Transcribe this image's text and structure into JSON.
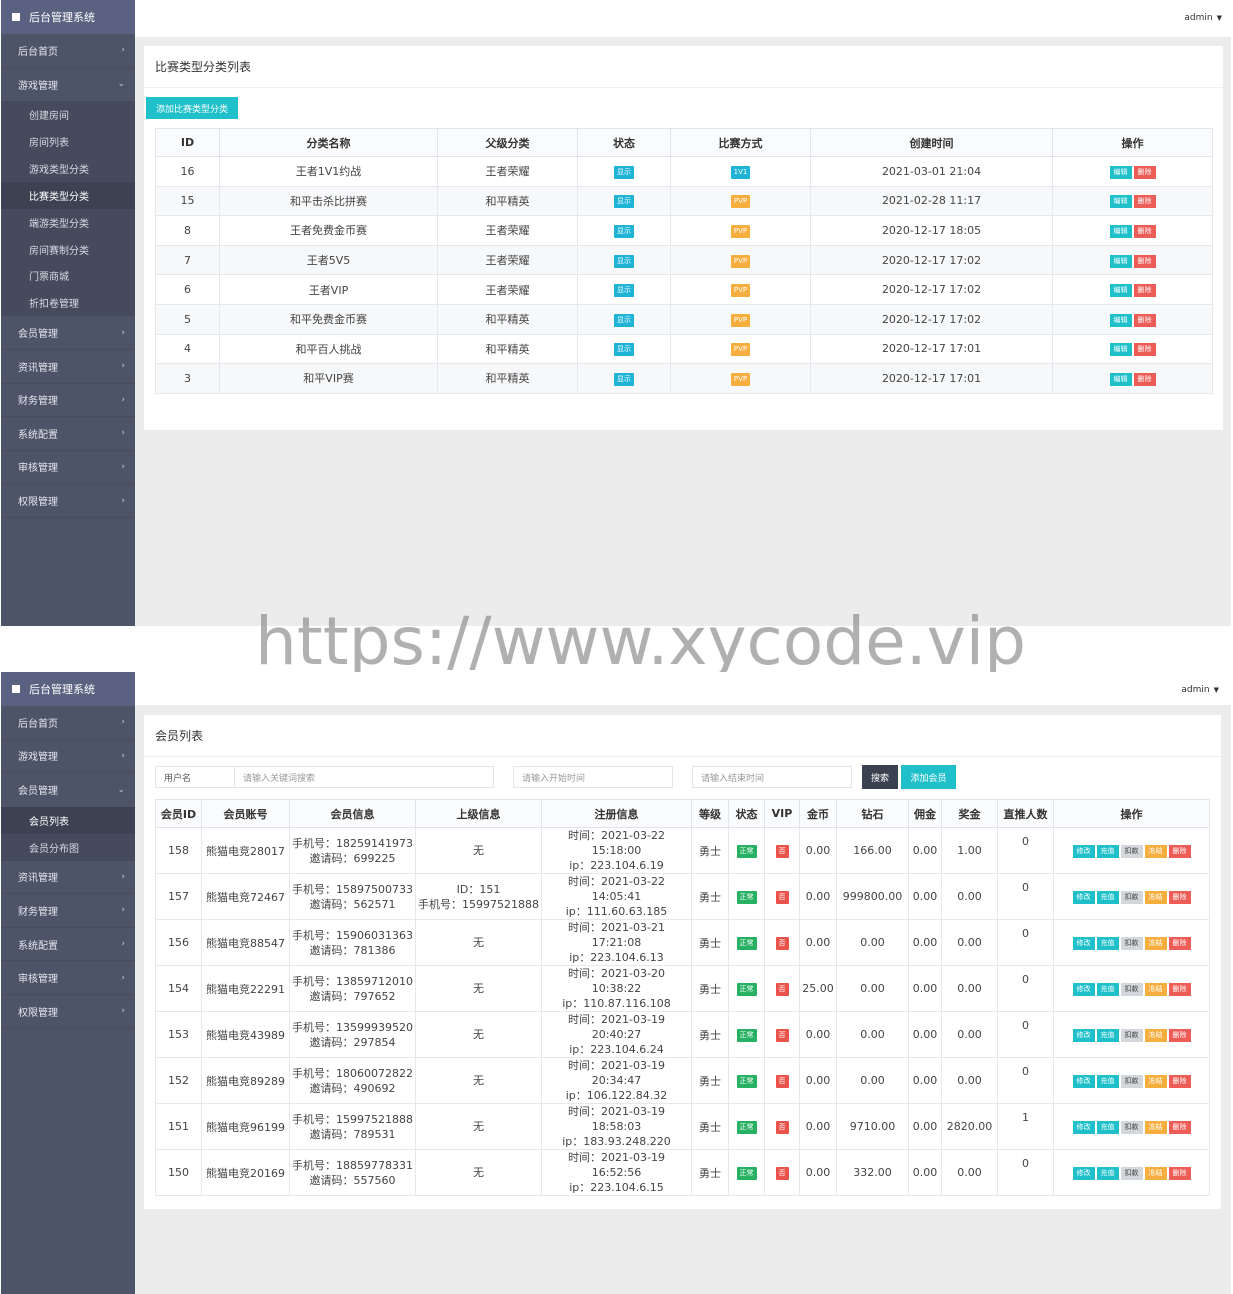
{
  "screen1": {
    "brand": "后台管理系统",
    "user": "admin",
    "menu_top": [
      {
        "label": "后台首页"
      },
      {
        "label": "游戏管理"
      }
    ],
    "submenu": [
      "创建房间",
      "房间列表",
      "游戏类型分类",
      "比赛类型分类",
      "端游类型分类",
      "房间赛制分类",
      "门票商城",
      "折扣卷管理"
    ],
    "menu_bottom": [
      "会员管理",
      "资讯管理",
      "财务管理",
      "系统配置",
      "审核管理",
      "权限管理"
    ],
    "card_title": "比赛类型分类列表",
    "add_button": "添加比赛类型分类",
    "columns": [
      "ID",
      "分类名称",
      "父级分类",
      "状态",
      "比赛方式",
      "创建时间",
      "操作"
    ],
    "edit_label": "编辑",
    "delete_label": "删除",
    "rows": [
      {
        "id": "16",
        "name": "王者1V1约战",
        "parent": "王者荣耀",
        "status": "显示",
        "mode": "1V1",
        "time": "2021-03-01 21:04"
      },
      {
        "id": "15",
        "name": "和平击杀比拼赛",
        "parent": "和平精英",
        "status": "显示",
        "mode": "PVP",
        "time": "2021-02-28 11:17"
      },
      {
        "id": "8",
        "name": "王者免费金币赛",
        "parent": "王者荣耀",
        "status": "显示",
        "mode": "PVP",
        "time": "2020-12-17 18:05"
      },
      {
        "id": "7",
        "name": "王者5V5",
        "parent": "王者荣耀",
        "status": "显示",
        "mode": "PVP",
        "time": "2020-12-17 17:02"
      },
      {
        "id": "6",
        "name": "王者VIP",
        "parent": "王者荣耀",
        "status": "显示",
        "mode": "PVP",
        "time": "2020-12-17 17:02"
      },
      {
        "id": "5",
        "name": "和平免费金币赛",
        "parent": "和平精英",
        "status": "显示",
        "mode": "PVP",
        "time": "2020-12-17 17:02"
      },
      {
        "id": "4",
        "name": "和平百人挑战",
        "parent": "和平精英",
        "status": "显示",
        "mode": "PVP",
        "time": "2020-12-17 17:01"
      },
      {
        "id": "3",
        "name": "和平VIP赛",
        "parent": "和平精英",
        "status": "显示",
        "mode": "PVP",
        "time": "2020-12-17 17:01"
      }
    ]
  },
  "watermark": "https://www.xycode.vip",
  "screen2": {
    "brand": "后台管理系统",
    "user": "admin",
    "menu_top": [
      "后台首页",
      "游戏管理",
      "会员管理"
    ],
    "submenu": [
      "会员列表",
      "会员分布图"
    ],
    "menu_bottom": [
      "资讯管理",
      "财务管理",
      "系统配置",
      "审核管理",
      "权限管理"
    ],
    "card_title": "会员列表",
    "search": {
      "label": "用户名",
      "keyword_placeholder": "请输入关键词搜索",
      "start_placeholder": "请输入开始时间",
      "end_placeholder": "请输入结束时间",
      "search_button": "搜索",
      "add_button": "添加会员"
    },
    "columns": [
      "会员ID",
      "会员账号",
      "会员信息",
      "上级信息",
      "注册信息",
      "等级",
      "状态",
      "VIP",
      "金币",
      "钻石",
      "佣金",
      "奖金",
      "直推人数",
      "操作"
    ],
    "ops": [
      "修改",
      "充值",
      "扣款",
      "冻结",
      "删除"
    ],
    "rows": [
      {
        "id": "158",
        "account": "熊猫电竞28017",
        "phone": "手机号：18259141973",
        "invite": "邀请码：699225",
        "parent1": "无",
        "parent2": "",
        "reg_time": "时间：2021-03-22 15:18:00",
        "reg_ip": "ip：223.104.6.19",
        "level": "勇士",
        "status": "正常",
        "vip": "否",
        "gold": "0.00",
        "diamond": "166.00",
        "commission": "0.00",
        "bonus": "1.00",
        "direct": "0"
      },
      {
        "id": "157",
        "account": "熊猫电竞72467",
        "phone": "手机号：15897500733",
        "invite": "邀请码：562571",
        "parent1": "ID：151",
        "parent2": "手机号：15997521888",
        "reg_time": "时间：2021-03-22 14:05:41",
        "reg_ip": "ip：111.60.63.185",
        "level": "勇士",
        "status": "正常",
        "vip": "否",
        "gold": "0.00",
        "diamond": "999800.00",
        "commission": "0.00",
        "bonus": "0.00",
        "direct": "0"
      },
      {
        "id": "156",
        "account": "熊猫电竞88547",
        "phone": "手机号：15906031363",
        "invite": "邀请码：781386",
        "parent1": "无",
        "parent2": "",
        "reg_time": "时间：2021-03-21 17:21:08",
        "reg_ip": "ip：223.104.6.13",
        "level": "勇士",
        "status": "正常",
        "vip": "否",
        "gold": "0.00",
        "diamond": "0.00",
        "commission": "0.00",
        "bonus": "0.00",
        "direct": "0"
      },
      {
        "id": "154",
        "account": "熊猫电竞22291",
        "phone": "手机号：13859712010",
        "invite": "邀请码：797652",
        "parent1": "无",
        "parent2": "",
        "reg_time": "时间：2021-03-20 10:38:22",
        "reg_ip": "ip：110.87.116.108",
        "level": "勇士",
        "status": "正常",
        "vip": "否",
        "gold": "25.00",
        "diamond": "0.00",
        "commission": "0.00",
        "bonus": "0.00",
        "direct": "0"
      },
      {
        "id": "153",
        "account": "熊猫电竞43989",
        "phone": "手机号：13599939520",
        "invite": "邀请码：297854",
        "parent1": "无",
        "parent2": "",
        "reg_time": "时间：2021-03-19 20:40:27",
        "reg_ip": "ip：223.104.6.24",
        "level": "勇士",
        "status": "正常",
        "vip": "否",
        "gold": "0.00",
        "diamond": "0.00",
        "commission": "0.00",
        "bonus": "0.00",
        "direct": "0"
      },
      {
        "id": "152",
        "account": "熊猫电竞89289",
        "phone": "手机号：18060072822",
        "invite": "邀请码：490692",
        "parent1": "无",
        "parent2": "",
        "reg_time": "时间：2021-03-19 20:34:47",
        "reg_ip": "ip：106.122.84.32",
        "level": "勇士",
        "status": "正常",
        "vip": "否",
        "gold": "0.00",
        "diamond": "0.00",
        "commission": "0.00",
        "bonus": "0.00",
        "direct": "0"
      },
      {
        "id": "151",
        "account": "熊猫电竞96199",
        "phone": "手机号：15997521888",
        "invite": "邀请码：789531",
        "parent1": "无",
        "parent2": "",
        "reg_time": "时间：2021-03-19 18:58:03",
        "reg_ip": "ip：183.93.248.220",
        "level": "勇士",
        "status": "正常",
        "vip": "否",
        "gold": "0.00",
        "diamond": "9710.00",
        "commission": "0.00",
        "bonus": "2820.00",
        "direct": "1"
      },
      {
        "id": "150",
        "account": "熊猫电竞20169",
        "phone": "手机号：18859778331",
        "invite": "邀请码：557560",
        "parent1": "无",
        "parent2": "",
        "reg_time": "时间：2021-03-19 16:52:56",
        "reg_ip": "ip：223.104.6.15",
        "level": "勇士",
        "status": "正常",
        "vip": "否",
        "gold": "0.00",
        "diamond": "332.00",
        "commission": "0.00",
        "bonus": "0.00",
        "direct": "0"
      }
    ]
  }
}
